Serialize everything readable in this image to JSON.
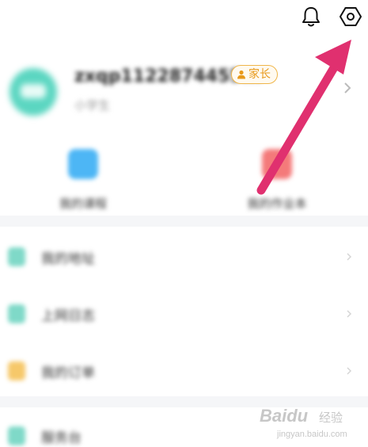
{
  "header": {
    "bell_icon": "bell-icon",
    "settings_icon": "settings-hexagon-icon"
  },
  "profile": {
    "nickname": "zxqp1122874455...",
    "sub_text": "小学生",
    "role_badge": "家长",
    "avatar_color": "#5bd6c1"
  },
  "quick_actions": [
    {
      "label": "我的课程",
      "color": "#4db6f5"
    },
    {
      "label": "我的作业本",
      "color": "#f47a7a"
    }
  ],
  "menu": [
    {
      "label": "我的地址",
      "color": "#7fd9c8"
    },
    {
      "label": "上网日志",
      "color": "#7fd9c8"
    },
    {
      "label": "我的订单",
      "color": "#f6c86a"
    },
    {
      "label": "服务台",
      "color": "#7fd9c8"
    }
  ],
  "annotation": {
    "arrow_color": "#e0306f"
  },
  "watermark": {
    "brand": "Baidu",
    "brand_cn": "经验",
    "url": "jingyan.baidu.com"
  }
}
